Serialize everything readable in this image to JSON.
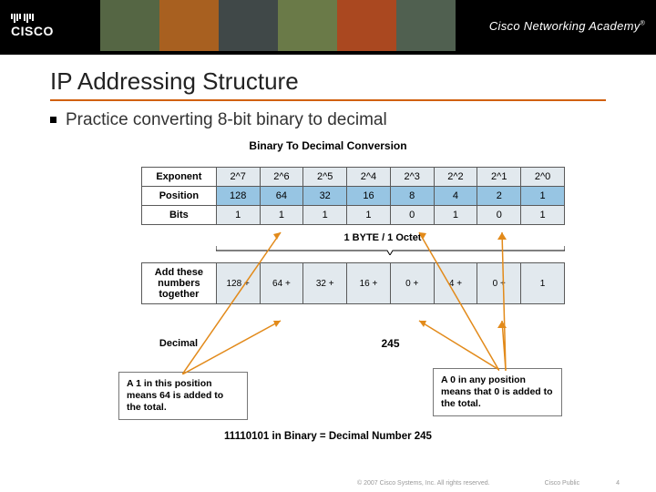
{
  "header": {
    "brand": "CISCO",
    "academy": "Cisco Networking Academy",
    "tm": "®"
  },
  "title": "IP Addressing Structure",
  "bullet": "Practice converting 8-bit binary to decimal",
  "fig": {
    "title": "Binary To Decimal Conversion",
    "rows": {
      "exponent": {
        "label": "Exponent",
        "vals": [
          "2^7",
          "2^6",
          "2^5",
          "2^4",
          "2^3",
          "2^2",
          "2^1",
          "2^0"
        ]
      },
      "position": {
        "label": "Position",
        "vals": [
          "128",
          "64",
          "32",
          "16",
          "8",
          "4",
          "2",
          "1"
        ]
      },
      "bits": {
        "label": "Bits",
        "vals": [
          "1",
          "1",
          "1",
          "1",
          "0",
          "1",
          "0",
          "1"
        ]
      },
      "byte_label": "1 BYTE / 1 Octet",
      "add": {
        "label": "Add these numbers together",
        "expr": [
          "128 +",
          "64 +",
          "32 +",
          "16 +",
          "0  +",
          "4  +",
          "0  +",
          "1"
        ]
      },
      "decimal": {
        "label": "Decimal",
        "value": "245"
      }
    },
    "note_left": "A 1 in this position means 64 is added to the total.",
    "note_right": "A 0 in any position means that 0 is added to the total.",
    "summary": "11110101 in Binary = Decimal Number 245"
  },
  "footer": {
    "copyright": "© 2007 Cisco Systems, Inc. All rights reserved.",
    "label": "Cisco Public",
    "page": "4"
  },
  "chart_data": {
    "type": "table",
    "title": "Binary To Decimal Conversion",
    "columns": [
      "2^7",
      "2^6",
      "2^5",
      "2^4",
      "2^3",
      "2^2",
      "2^1",
      "2^0"
    ],
    "position_values": [
      128,
      64,
      32,
      16,
      8,
      4,
      2,
      1
    ],
    "bits": [
      1,
      1,
      1,
      1,
      0,
      1,
      0,
      1
    ],
    "addends": [
      128,
      64,
      32,
      16,
      0,
      4,
      0,
      1
    ],
    "decimal_result": 245,
    "binary_string": "11110101"
  }
}
